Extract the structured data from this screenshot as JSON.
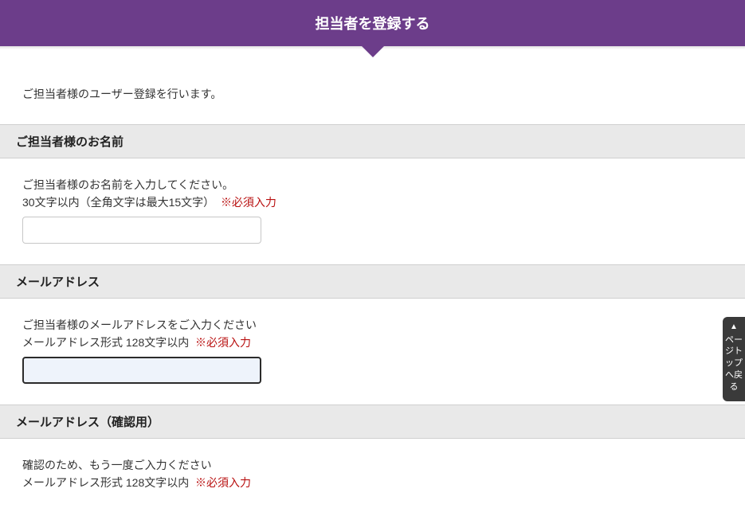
{
  "header": {
    "title": "担当者を登録する"
  },
  "intro": {
    "text": "ご担当者様のユーザー登録を行います。"
  },
  "sections": {
    "name": {
      "heading": "ご担当者様のお名前",
      "help": "ご担当者様のお名前を入力してください。",
      "constraint": "30文字以内（全角文字は最大15文字）",
      "required": "※必須入力",
      "value": ""
    },
    "email": {
      "heading": "メールアドレス",
      "help": "ご担当者様のメールアドレスをご入力ください",
      "constraint": "メールアドレス形式 128文字以内",
      "required": "※必須入力",
      "value": ""
    },
    "emailConfirm": {
      "heading": "メールアドレス（確認用）",
      "help": "確認のため、もう一度ご入力ください",
      "constraint": "メールアドレス形式 128文字以内",
      "required": "※必須入力"
    }
  },
  "pageTop": {
    "label": "ページトップへ戻る"
  }
}
